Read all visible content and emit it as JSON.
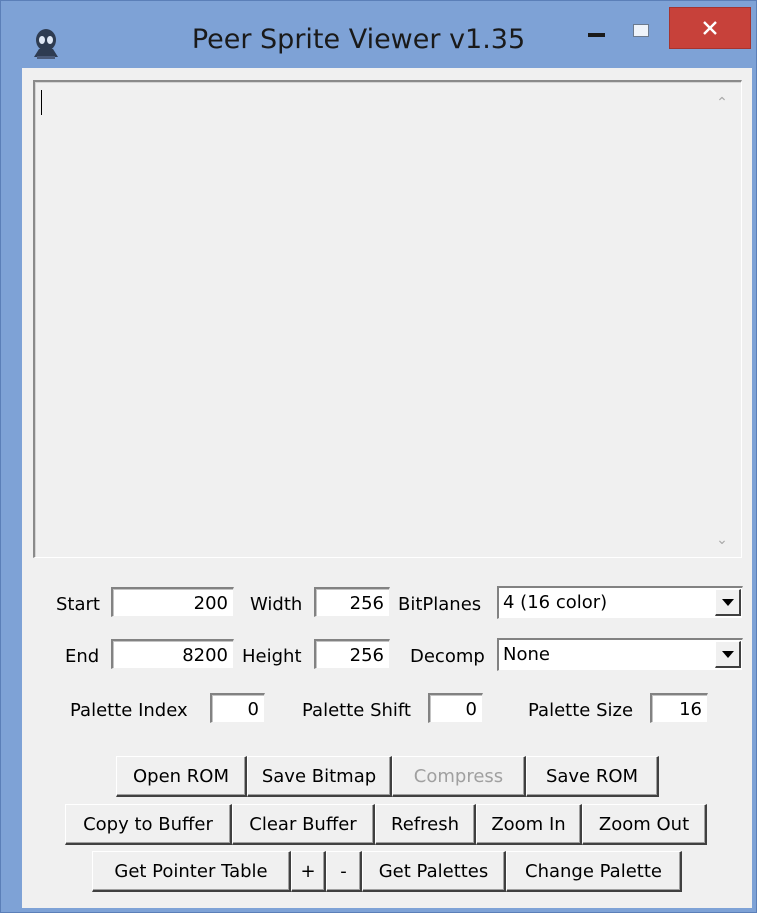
{
  "window": {
    "title": "Peer Sprite Viewer v1.35",
    "icon": "alien-icon"
  },
  "controls": {
    "start": {
      "label": "Start",
      "value": "200"
    },
    "end": {
      "label": "End",
      "value": "8200"
    },
    "width": {
      "label": "Width",
      "value": "256"
    },
    "height": {
      "label": "Height",
      "value": "256"
    },
    "bitplanes": {
      "label": "BitPlanes",
      "value": "4 (16 color)"
    },
    "decomp": {
      "label": "Decomp",
      "value": "None"
    },
    "palette_index": {
      "label": "Palette Index",
      "value": "0"
    },
    "palette_shift": {
      "label": "Palette Shift",
      "value": "0"
    },
    "palette_size": {
      "label": "Palette Size",
      "value": "16"
    }
  },
  "buttons": {
    "row1": [
      "Open ROM",
      "Save Bitmap",
      "Compress",
      "Save ROM"
    ],
    "row2": [
      "Copy to Buffer",
      "Clear Buffer",
      "Refresh",
      "Zoom In",
      "Zoom Out"
    ],
    "row3": [
      "Get Pointer Table",
      "+",
      "-",
      "Get Palettes",
      "Change Palette"
    ]
  },
  "colors": {
    "title_bar": "#7ea2d6",
    "close_button": "#c7413a",
    "client": "#f0f0f0"
  }
}
